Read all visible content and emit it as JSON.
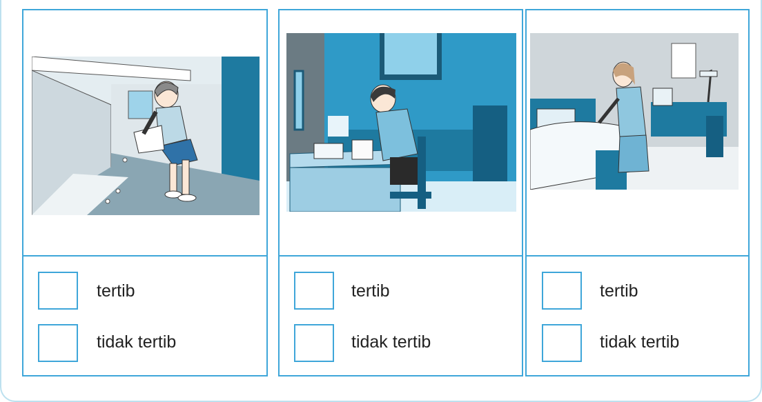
{
  "cards": [
    {
      "scene": "boy dumping trash into a drain",
      "options": [
        {
          "label": "tertib"
        },
        {
          "label": "tidak tertib"
        }
      ]
    },
    {
      "scene": "boy reading a book at a desk in his bedroom",
      "options": [
        {
          "label": "tertib"
        },
        {
          "label": "tidak tertib"
        }
      ]
    },
    {
      "scene": "girl making her bed",
      "options": [
        {
          "label": "tertib"
        },
        {
          "label": "tidak tertib"
        }
      ]
    }
  ],
  "colors": {
    "border": "#3ea6d9",
    "outer_frame": "#bde1ef",
    "illustration_blue": "#2f9ac7"
  }
}
